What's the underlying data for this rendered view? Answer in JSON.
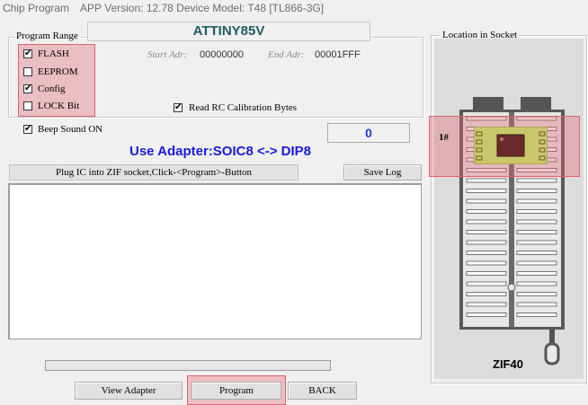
{
  "title_bar": {
    "left": "Chip Program",
    "right": "APP Version: 12.78 Device Model: T48 [TL866-3G]"
  },
  "chip_name": "ATTINY85V",
  "program_range": {
    "legend": "Program Range",
    "items": [
      {
        "label": "FLASH",
        "checked": true
      },
      {
        "label": "EEPROM",
        "checked": false
      },
      {
        "label": "Config",
        "checked": true
      },
      {
        "label": "LOCK Bit",
        "checked": false
      }
    ],
    "start_adr_label": "Start Adr:",
    "start_adr_value": "00000000",
    "end_adr_label": "End Adr:",
    "end_adr_value": "00001FFF",
    "read_rc": {
      "label": "Read RC Calibration Bytes",
      "checked": true
    }
  },
  "beep": {
    "label": "Beep Sound ON",
    "checked": true
  },
  "counter": "0",
  "adapter_text": "Use Adapter:SOIC8 <-> DIP8",
  "status": "Plug IC into ZIF socket,Click-<Program>-Button",
  "buttons": {
    "save_log": "Save Log",
    "view_adapter": "View Adapter",
    "program": "Program",
    "back": "BACK"
  },
  "socket": {
    "legend": "Location in Socket",
    "pin1_label": "1#",
    "zif_label": "ZIF40"
  },
  "progress": 0,
  "colors": {
    "highlight": "#e06070",
    "chip_name": "#1f5c5e",
    "adapter_text": "#1a1adc",
    "counter": "#1a3ad8"
  }
}
